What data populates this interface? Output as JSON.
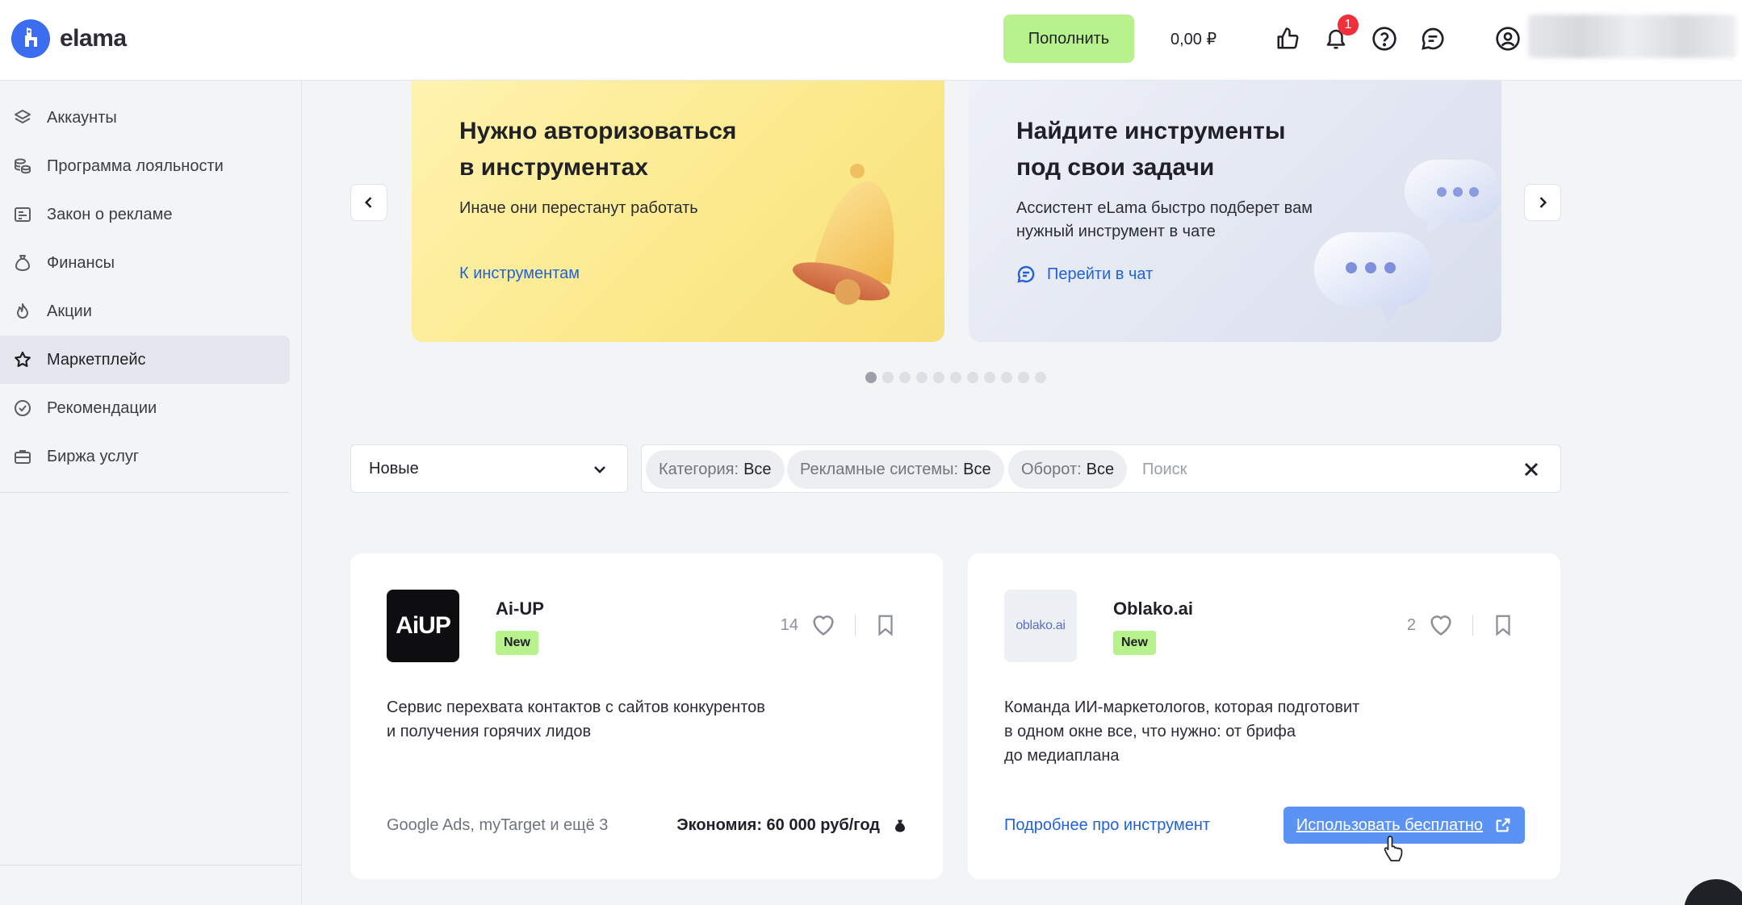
{
  "header": {
    "logo_text": "elama",
    "topup_label": "Пополнить",
    "balance": "0,00 ₽",
    "notifications_count": "1"
  },
  "sidebar": {
    "items": [
      {
        "label": "Аккаунты",
        "icon": "layers-icon"
      },
      {
        "label": "Программа лояльности",
        "icon": "coins-icon"
      },
      {
        "label": "Закон о рекламе",
        "icon": "document-icon"
      },
      {
        "label": "Финансы",
        "icon": "money-bag-icon"
      },
      {
        "label": "Акции",
        "icon": "flame-icon"
      },
      {
        "label": "Маркетплейс",
        "icon": "star-icon",
        "active": true
      },
      {
        "label": "Рекомендации",
        "icon": "check-circle-icon"
      },
      {
        "label": "Биржа услуг",
        "icon": "briefcase-icon"
      }
    ]
  },
  "carousel": {
    "banners": [
      {
        "title_line1": "Нужно авторизоваться",
        "title_line2": "в инструментах",
        "subtitle": "Иначе они перестанут работать",
        "link": "К инструментам"
      },
      {
        "title_line1": "Найдите инструменты",
        "title_line2": "под свои задачи",
        "subtitle_line1": "Ассистент eLama быстро подберет вам",
        "subtitle_line2": "нужный инструмент в чате",
        "link": "Перейти в чат"
      }
    ],
    "dots_total": 11,
    "active_dot": 1
  },
  "filters": {
    "sort_value": "Новые",
    "chips": [
      {
        "label": "Категория:",
        "value": "Все"
      },
      {
        "label": "Рекламные системы:",
        "value": "Все"
      },
      {
        "label": "Оборот:",
        "value": "Все"
      }
    ],
    "search_placeholder": "Поиск"
  },
  "cards": [
    {
      "name": "Ai-UP",
      "badge": "New",
      "likes": "14",
      "logo_text": "AiUP",
      "desc_line1": "Сервис перехвата контактов с сайтов конкурентов",
      "desc_line2": "и получения горячих лидов",
      "systems": "Google Ads, myTarget и ещё 3",
      "savings": "Экономия: 60 000 руб/год"
    },
    {
      "name": "Oblako.ai",
      "badge": "New",
      "likes": "2",
      "logo_text": "oblako.ai",
      "desc_line1": "Команда ИИ-маркетологов, которая подготовит",
      "desc_line2": "в одном окне все, что нужно: от брифа",
      "desc_line3": "до медиаплана",
      "more_link": "Подробнее про инструмент",
      "use_button": "Использовать бесплатно"
    }
  ],
  "colors": {
    "accent_green": "#b8f28c",
    "link_blue": "#2262d8",
    "button_blue": "#5b93f5",
    "badge_red": "#f0303a"
  }
}
